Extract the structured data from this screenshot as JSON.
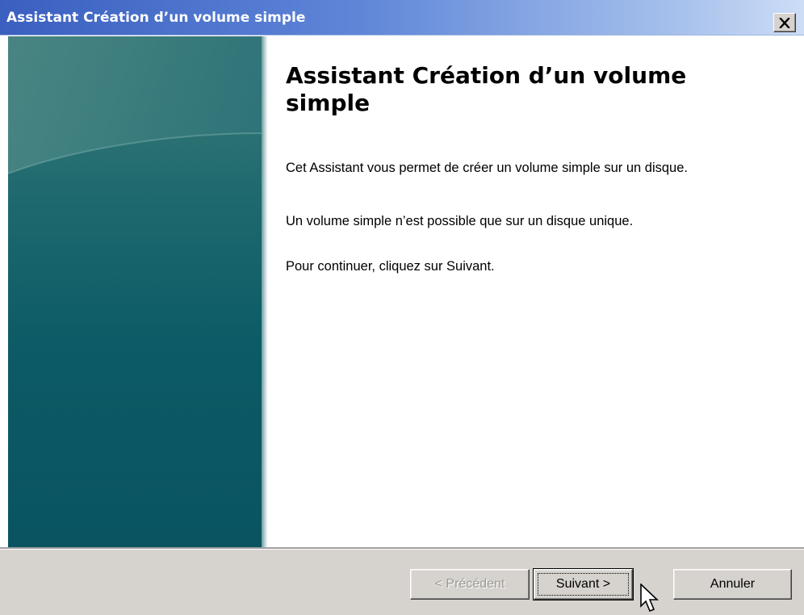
{
  "window": {
    "title": "Assistant Création d’un volume simple",
    "close_icon": "close-icon"
  },
  "sidebar": {
    "image": "wizard-banner-teal",
    "colors": [
      "#3f7d7a",
      "#0c5b66"
    ]
  },
  "content": {
    "heading": "Assistant Création d’un volume simple",
    "paragraphs": [
      "Cet Assistant vous permet de créer un volume simple sur un disque.",
      "Un volume simple n’est possible que sur un disque unique.",
      "Pour continuer, cliquez sur Suivant."
    ]
  },
  "footer": {
    "prev_label": "< Précédent",
    "next_label": "Suivant >",
    "cancel_label": "Annuler",
    "prev_enabled": false
  },
  "cursor": "arrow-cursor-icon"
}
